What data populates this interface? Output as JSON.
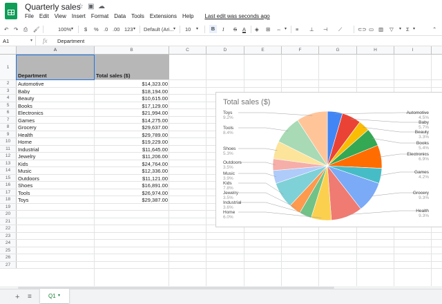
{
  "doc": {
    "title": "Quarterly sales",
    "menus": [
      "File",
      "Edit",
      "View",
      "Insert",
      "Format",
      "Data",
      "Tools",
      "Extensions",
      "Help"
    ],
    "last_edit": "Last edit was seconds ago"
  },
  "toolbar": {
    "zoom": "100%",
    "currency": "$",
    "percent": "%",
    "dec_decrease": ".0",
    "dec_increase": ".00",
    "more_formats": "123",
    "font": "Default (Ari...",
    "font_size": "10",
    "bold": "B",
    "italic": "I",
    "strike": "S",
    "text_color": "A"
  },
  "formula_bar": {
    "cell_ref": "A1",
    "content": "Department"
  },
  "columns": [
    "A",
    "B",
    "C",
    "D",
    "E",
    "F",
    "G",
    "H",
    "I"
  ],
  "sheet": {
    "headers": {
      "a": "Department",
      "b": "Total sales ($)"
    },
    "rows": [
      {
        "n": "2",
        "a": "Automotive",
        "b": "$14,323.00"
      },
      {
        "n": "3",
        "a": "Baby",
        "b": "$18,194.00"
      },
      {
        "n": "4",
        "a": "Beauty",
        "b": "$10,615.00"
      },
      {
        "n": "5",
        "a": "Books",
        "b": "$17,129.00"
      },
      {
        "n": "6",
        "a": "Electronics",
        "b": "$21,994.00"
      },
      {
        "n": "7",
        "a": "Games",
        "b": "$14,275.00"
      },
      {
        "n": "8",
        "a": "Grocery",
        "b": "$29,637.00"
      },
      {
        "n": "9",
        "a": "Health",
        "b": "$29,789.00"
      },
      {
        "n": "10",
        "a": "Home",
        "b": "$19,229.00"
      },
      {
        "n": "11",
        "a": "Industrial",
        "b": "$11,645.00"
      },
      {
        "n": "12",
        "a": "Jewelry",
        "b": "$11,206.00"
      },
      {
        "n": "13",
        "a": "Kids",
        "b": "$24,764.00"
      },
      {
        "n": "14",
        "a": "Music",
        "b": "$12,336.00"
      },
      {
        "n": "15",
        "a": "Outdoors",
        "b": "$11,121.00"
      },
      {
        "n": "16",
        "a": "Shoes",
        "b": "$16,891.00"
      },
      {
        "n": "17",
        "a": "Tools",
        "b": "$26,974.00"
      },
      {
        "n": "18",
        "a": "Toys",
        "b": "$29,387.00"
      }
    ],
    "empty_rows": [
      "19",
      "20",
      "21",
      "22",
      "23",
      "24",
      "25",
      "26",
      "27"
    ],
    "row1_num": "1"
  },
  "tabs": {
    "active": "Q1"
  },
  "chart_data": {
    "type": "pie",
    "title": "Total sales ($)",
    "categories": [
      "Automotive",
      "Baby",
      "Beauty",
      "Books",
      "Electronics",
      "Games",
      "Grocery",
      "Health",
      "Home",
      "Industrial",
      "Jewelry",
      "Kids",
      "Music",
      "Outdoors",
      "Shoes",
      "Tools",
      "Toys"
    ],
    "values": [
      14323,
      18194,
      10615,
      17129,
      21994,
      14275,
      29637,
      29789,
      19229,
      11645,
      11206,
      24764,
      12336,
      11121,
      16891,
      26974,
      29387
    ],
    "percent_labels": [
      "4.5%",
      "5.7%",
      "3.3%",
      "5.4%",
      "6.9%",
      "4.2%",
      "9.3%",
      "9.3%",
      "6.0%",
      "3.6%",
      "3.5%",
      "7.8%",
      "3.9%",
      "3.5%",
      "5.3%",
      "8.4%",
      "9.2%"
    ],
    "colors": [
      "#4285f4",
      "#ea4335",
      "#fbbc04",
      "#34a853",
      "#ff6d01",
      "#46bdc6",
      "#7baaf7",
      "#f07b72",
      "#fcd04f",
      "#71c287",
      "#ff994d",
      "#7ed1d7",
      "#aecbfa",
      "#f6aea9",
      "#fde49b",
      "#a8dab5",
      "#ffc599"
    ],
    "legend": "labels-around"
  }
}
